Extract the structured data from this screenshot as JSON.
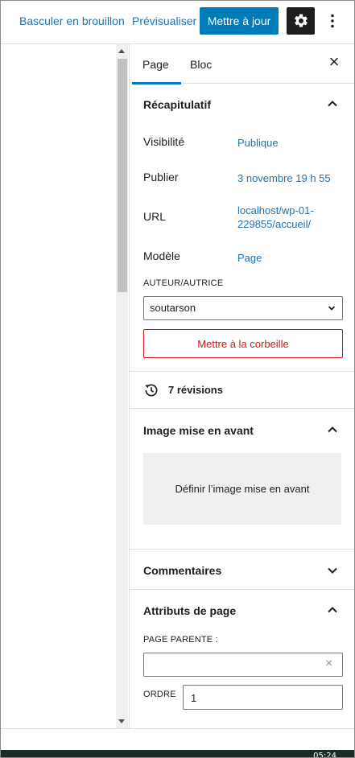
{
  "toolbar": {
    "switch_to_draft": "Basculer en brouillon",
    "preview": "Prévisualiser",
    "update": "Mettre à jour",
    "settings_icon": "gear-icon",
    "options_icon": "kebab-icon"
  },
  "sidebar": {
    "tabs": [
      {
        "label": "Page",
        "active": true
      },
      {
        "label": "Bloc",
        "active": false
      }
    ],
    "close_icon": "close-icon",
    "summary": {
      "title": "Récapitulatif",
      "rows": [
        {
          "label": "Visibilité",
          "value": "Publique"
        },
        {
          "label": "Publier",
          "value": "3 novembre 19 h 55"
        },
        {
          "label": "URL",
          "value": "localhost/wp-01-229855/accueil/"
        },
        {
          "label": "Modèle",
          "value": "Page"
        }
      ],
      "author_label": "AUTEUR/AUTRICE",
      "author_value": "soutarson",
      "trash": "Mettre à la corbeille"
    },
    "revisions": "7 révisions",
    "featured_image": {
      "title": "Image mise en avant",
      "button": "Définir l’image mise en avant"
    },
    "comments": {
      "title": "Commentaires"
    },
    "page_attributes": {
      "title": "Attributs de page",
      "parent_label": "PAGE PARENTE :",
      "parent_value": "",
      "order_label": "ORDRE",
      "order_value": "1"
    }
  },
  "taskbar": {
    "clock": "05:24"
  },
  "colors": {
    "accent": "#007cba",
    "link": "#2271b1",
    "danger": "#cc1818",
    "dark": "#1e1e1e"
  }
}
